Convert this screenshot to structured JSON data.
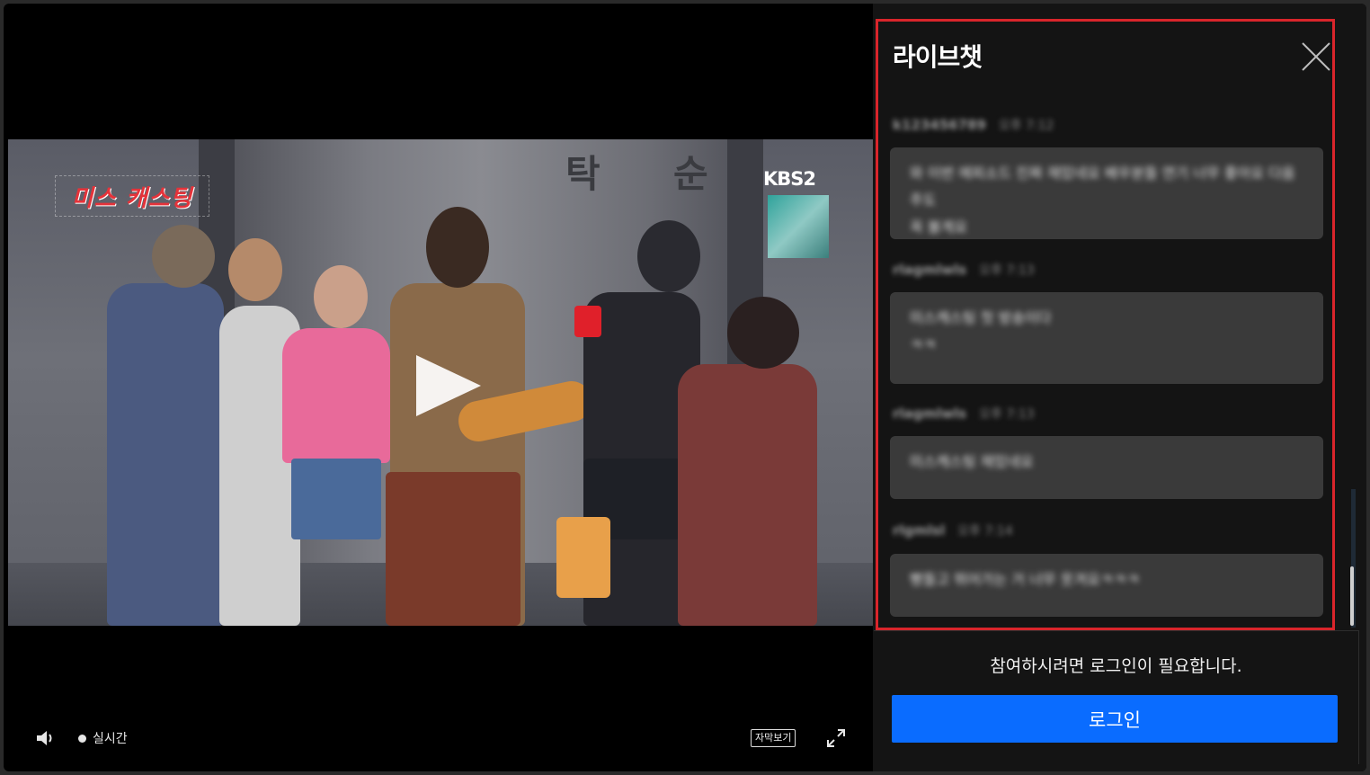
{
  "player": {
    "show_logo": "미스 캐스팅",
    "channel_logo": "KBS2",
    "sign_chars": [
      "탁",
      "순"
    ],
    "controls": {
      "live_label": "실시간",
      "subtitle_label": "자막보기"
    },
    "icons": {
      "play": "play-icon",
      "volume": "speaker-volume-icon",
      "fullscreen": "expand-arrows-icon"
    }
  },
  "chat": {
    "title": "라이브챗",
    "close_icon": "close-x-icon",
    "messages": [
      {
        "user": "k123456789",
        "time": "오후 7:12",
        "text": "와 이번 에피소드 진짜 재밌네요 배우분들 연기 너무 좋아요 다음주도\n꼭 볼게요"
      },
      {
        "user": "rlagmlwls",
        "time": "오후 7:13",
        "text": "미스캐스팅 첫 방송이다\nㅋㅋ"
      },
      {
        "user": "rlagmlwls",
        "time": "오후 7:13",
        "text": "미스캐스팅 재밌네요"
      },
      {
        "user": "rlgmlsl",
        "time": "오후 7:14",
        "text": "빵들고 뛰어가는 거 너무 웃겨요ㅋㅋㅋ"
      }
    ],
    "login_notice": "참여하시려면 로그인이 필요합니다.",
    "login_button": "로그인"
  },
  "colors": {
    "accent_blue": "#0a6cff",
    "highlight_red": "#d9252b",
    "logo_red": "#e5333a",
    "panel_bg": "#141414",
    "bubble_bg": "#3a3a3a"
  }
}
